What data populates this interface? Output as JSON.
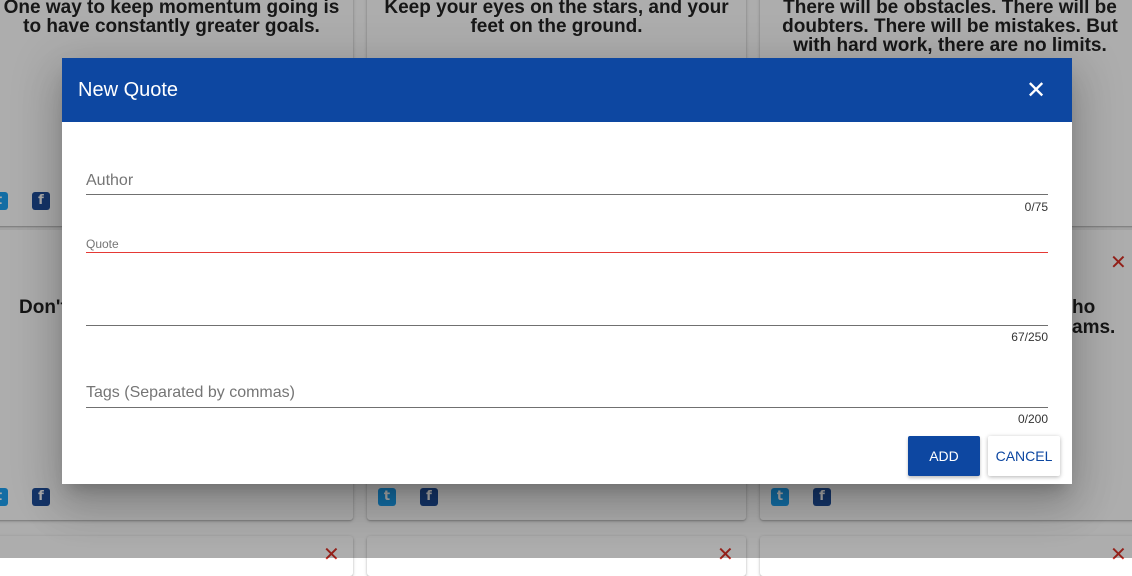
{
  "background": {
    "cards": [
      {
        "text": "One way to keep momentum going is to have constantly greater goals."
      },
      {
        "text": "Keep your eyes on the stars, and your feet on the ground."
      },
      {
        "text": "There will be obstacles. There will be doubters. There will be mistakes. But with hard work, there are no limits."
      }
    ],
    "partial_left": "Don't",
    "partial_right_1": "ho",
    "partial_right_2": "ams.",
    "icons": {
      "twitter": "twitter-icon",
      "facebook": "facebook-icon",
      "delete": "close-icon"
    },
    "twitter_glyph": "t",
    "facebook_glyph": "f",
    "delete_glyph": "✕"
  },
  "dialog": {
    "title": "New Quote",
    "close_glyph": "✕",
    "fields": {
      "author": {
        "label": "Author",
        "counter": "0/75"
      },
      "quote": {
        "label": "Quote",
        "counter": "67/250"
      },
      "tags": {
        "label": "Tags (Separated by commas)",
        "counter": "0/200"
      }
    },
    "buttons": {
      "add": "ADD",
      "cancel": "CANCEL"
    }
  },
  "colors": {
    "primary": "#0d47a1",
    "error": "#e53935",
    "twitter": "#1da1f2",
    "facebook": "#1f4e9b",
    "delete": "#d93025"
  }
}
